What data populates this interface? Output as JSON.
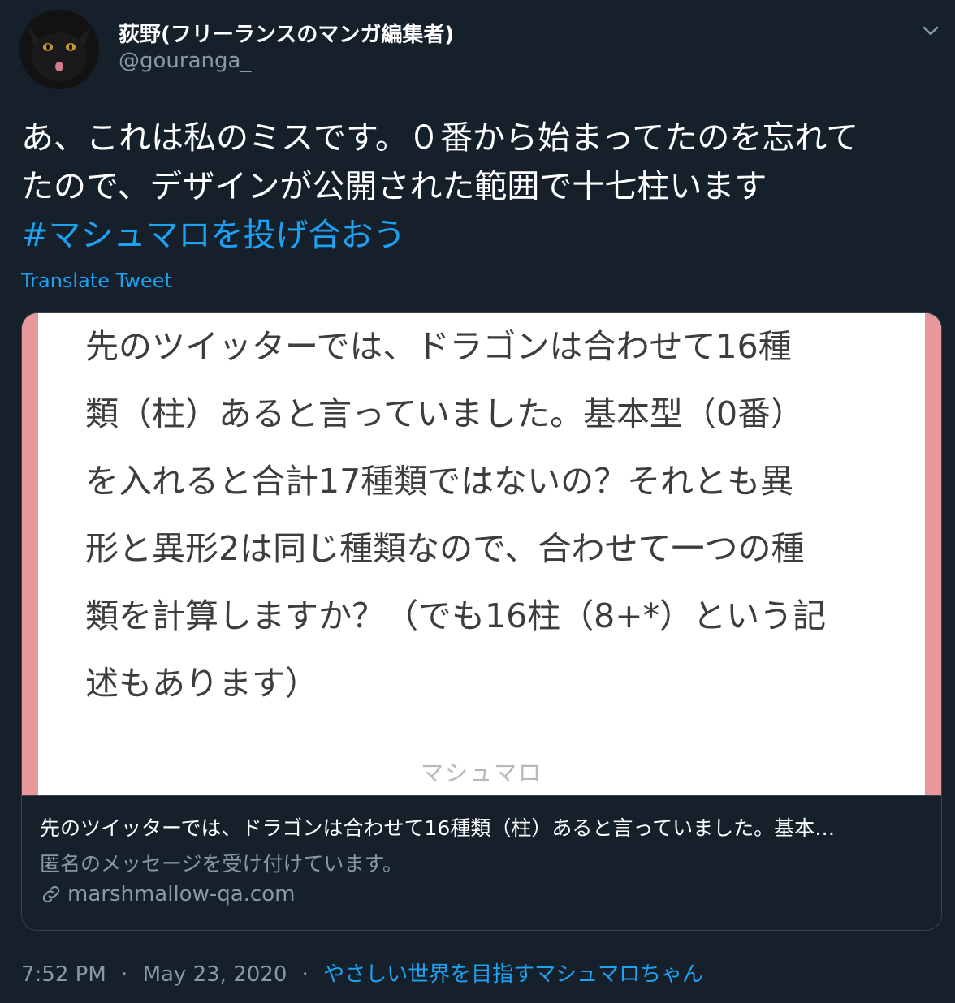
{
  "author": {
    "name": "荻野(フリーランスのマンガ編集者)",
    "handle": "@gouranga_"
  },
  "tweet": {
    "lines": [
      "あ、これは私のミスです。０番から始まってたのを忘れて",
      "たので、デザインが公開された範囲で十七柱います"
    ],
    "hashtag": "#マシュマロを投げ合おう",
    "translate_label": "Translate Tweet"
  },
  "card": {
    "image_lines": [
      "先のツイッターでは、ドラゴンは合わせて16種",
      "類（柱）あると言っていました。基本型（0番）",
      "を入れると合計17種類ではないの？それとも異",
      "形と異形2は同じ種類なので、合わせて一つの種",
      "類を計算しますか？（でも16柱（8+*）という記",
      "述もあります）"
    ],
    "image_footer": "マシュマロ",
    "title": "先のツイッターでは、ドラゴンは合わせて16種類（柱）あると言っていました。基本…",
    "description": "匿名のメッセージを受け付けています。",
    "domain": "marshmallow-qa.com"
  },
  "meta": {
    "time": "7:52 PM",
    "separator": "·",
    "date": "May 23, 2020",
    "source": "やさしい世界を目指すマシュマロちゃん"
  },
  "colors": {
    "background": "#15202b",
    "link": "#1da1f2",
    "muted": "#8899a6",
    "card_border": "#38444d",
    "card_accent": "#e8989a"
  },
  "icons": {
    "caret": "chevron-down-icon",
    "link": "link-icon",
    "avatar": "black-cat-avatar"
  }
}
